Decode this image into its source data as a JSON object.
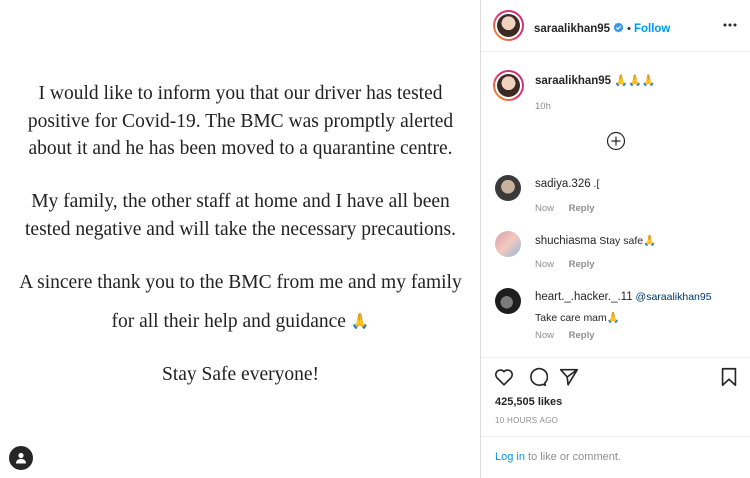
{
  "post": {
    "paragraph1": [
      "I would like to inform you that our driver has tested",
      "positive for Covid-19. The BMC was promptly alerted",
      "about it and he has been moved to a quarantine centre."
    ],
    "paragraph2": [
      "My family, the other staff at home and I have all been",
      "tested negative and will take the necessary precautions."
    ],
    "paragraph3_line1": "A sincere thank you to the BMC from me and my family",
    "paragraph3_line2": "for all their help and guidance",
    "paragraph3_emoji": "🙏",
    "closing": "Stay Safe everyone!"
  },
  "header": {
    "username": "saraalikhan95",
    "verified_icon": "verified-badge-icon",
    "separator": "•",
    "follow_label": "Follow",
    "more_icon": "more-horizontal-icon"
  },
  "caption": {
    "username": "saraalikhan95",
    "text": "🙏🙏🙏",
    "time": "10h"
  },
  "load_more_icon": "plus-circle-icon",
  "comments": [
    {
      "username": "sadiya.326",
      "text": ".[",
      "time": "Now",
      "reply": "Reply"
    },
    {
      "username": "shuchiasma",
      "text": "Stay safe🙏",
      "time": "Now",
      "reply": "Reply"
    },
    {
      "username": "heart._.hacker._.11",
      "mention": "@saraalikhan95",
      "text": "Take care mam🙏",
      "time": "Now",
      "reply": "Reply"
    }
  ],
  "actions": {
    "like_icon": "heart-icon",
    "comment_icon": "comment-icon",
    "share_icon": "send-icon",
    "save_icon": "bookmark-icon"
  },
  "likes": "425,505 likes",
  "post_time": "10 HOURS AGO",
  "comment_bar": {
    "login_label": "Log in",
    "suffix": " to like or comment."
  },
  "colors": {
    "accent": "#0095f6",
    "text": "#262626",
    "muted": "#8e8e8e",
    "border": "#dbdbdb"
  }
}
